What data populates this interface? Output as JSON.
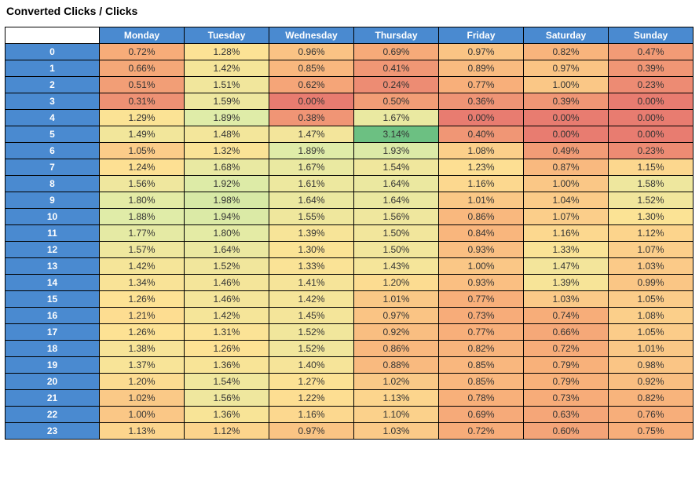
{
  "title": "Converted Clicks / Clicks",
  "days": [
    "Monday",
    "Tuesday",
    "Wednesday",
    "Thursday",
    "Friday",
    "Saturday",
    "Sunday"
  ],
  "hours": [
    "0",
    "1",
    "2",
    "3",
    "4",
    "5",
    "6",
    "7",
    "8",
    "9",
    "10",
    "11",
    "12",
    "13",
    "14",
    "15",
    "16",
    "17",
    "18",
    "19",
    "20",
    "21",
    "22",
    "23"
  ],
  "chart_data": {
    "type": "heatmap",
    "title": "Converted Clicks / Clicks",
    "xlabel": "",
    "ylabel": "",
    "x_categories": [
      "Monday",
      "Tuesday",
      "Wednesday",
      "Thursday",
      "Friday",
      "Saturday",
      "Sunday"
    ],
    "y_categories": [
      "0",
      "1",
      "2",
      "3",
      "4",
      "5",
      "6",
      "7",
      "8",
      "9",
      "10",
      "11",
      "12",
      "13",
      "14",
      "15",
      "16",
      "17",
      "18",
      "19",
      "20",
      "21",
      "22",
      "23"
    ],
    "unit": "percent",
    "values": [
      [
        0.72,
        1.28,
        0.96,
        0.69,
        0.97,
        0.82,
        0.47
      ],
      [
        0.66,
        1.42,
        0.85,
        0.41,
        0.89,
        0.97,
        0.39
      ],
      [
        0.51,
        1.51,
        0.62,
        0.24,
        0.77,
        1.0,
        0.23
      ],
      [
        0.31,
        1.59,
        0.0,
        0.5,
        0.36,
        0.39,
        0.0
      ],
      [
        1.29,
        1.89,
        0.38,
        1.67,
        0.0,
        0.0,
        0.0
      ],
      [
        1.49,
        1.48,
        1.47,
        3.14,
        0.4,
        0.0,
        0.0
      ],
      [
        1.05,
        1.32,
        1.89,
        1.93,
        1.08,
        0.49,
        0.23
      ],
      [
        1.24,
        1.68,
        1.67,
        1.54,
        1.23,
        0.87,
        1.15
      ],
      [
        1.56,
        1.92,
        1.61,
        1.64,
        1.16,
        1.0,
        1.58
      ],
      [
        1.8,
        1.98,
        1.64,
        1.64,
        1.01,
        1.04,
        1.52
      ],
      [
        1.88,
        1.94,
        1.55,
        1.56,
        0.86,
        1.07,
        1.3
      ],
      [
        1.77,
        1.8,
        1.39,
        1.5,
        0.84,
        1.16,
        1.12
      ],
      [
        1.57,
        1.64,
        1.3,
        1.5,
        0.93,
        1.33,
        1.07
      ],
      [
        1.42,
        1.52,
        1.33,
        1.43,
        1.0,
        1.47,
        1.03
      ],
      [
        1.34,
        1.46,
        1.41,
        1.2,
        0.93,
        1.39,
        0.99
      ],
      [
        1.26,
        1.46,
        1.42,
        1.01,
        0.77,
        1.03,
        1.05
      ],
      [
        1.21,
        1.42,
        1.45,
        0.97,
        0.73,
        0.74,
        1.08
      ],
      [
        1.26,
        1.31,
        1.52,
        0.92,
        0.77,
        0.66,
        1.05
      ],
      [
        1.38,
        1.26,
        1.52,
        0.86,
        0.82,
        0.72,
        1.01
      ],
      [
        1.37,
        1.36,
        1.4,
        0.88,
        0.85,
        0.79,
        0.98
      ],
      [
        1.2,
        1.54,
        1.27,
        1.02,
        0.85,
        0.79,
        0.92
      ],
      [
        1.02,
        1.56,
        1.22,
        1.13,
        0.78,
        0.73,
        0.82
      ],
      [
        1.0,
        1.36,
        1.16,
        1.1,
        0.69,
        0.63,
        0.76
      ],
      [
        1.13,
        1.12,
        0.97,
        1.03,
        0.72,
        0.6,
        0.75
      ]
    ],
    "value_range": [
      0.0,
      3.14
    ]
  }
}
